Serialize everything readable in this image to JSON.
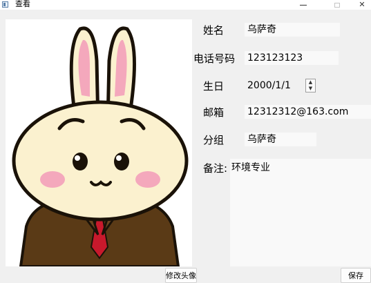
{
  "window": {
    "title": "查看",
    "minimize": "—",
    "maximize": "☐",
    "close": "✕"
  },
  "avatar": {
    "icon": "rabbit-avatar-image",
    "change_button": "修改头像"
  },
  "form": {
    "name_label": "姓名",
    "name_value": "乌萨奇",
    "phone_label": "电话号码",
    "phone_value": "123123123",
    "birthday_label": "生日",
    "birthday_value": "2000/1/1",
    "email_label": "邮箱",
    "email_value": "12312312@163.com",
    "group_label": "分组",
    "group_value": "乌萨奇",
    "notes_label": "备注:",
    "notes_value": "环境专业"
  },
  "save_button": "保存",
  "colors": {
    "background": "#f0f0f0",
    "field": "#f9f9f9",
    "rabbit_body": "#fbf1cf",
    "rabbit_blush": "#f4a8bc",
    "suit": "#5a3a16",
    "tie": "#c8192c"
  }
}
